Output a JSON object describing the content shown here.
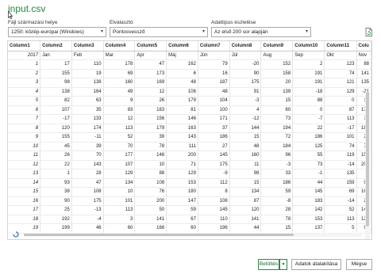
{
  "window": {
    "title": "input.csv"
  },
  "options": {
    "origin": {
      "label": "Fájl származási helye",
      "value": "1250: közép-európai (Windows)"
    },
    "delimiter": {
      "label": "Elválasztó",
      "value": "Pontosvessző"
    },
    "detection": {
      "label": "Adattípus észlelése",
      "value": "Az első 200 sor alapján"
    }
  },
  "table": {
    "headers": [
      "Column1",
      "Column2",
      "Column3",
      "Column4",
      "Column5",
      "Column6",
      "Column7",
      "Column8",
      "Column9",
      "Column10",
      "Column11",
      "Colu"
    ],
    "rows": [
      [
        "2017",
        "Jan",
        "Feb",
        "Mar",
        "Apr",
        "Máj",
        "Jún",
        "Júl",
        "Aug",
        "Sep",
        "Okt",
        "Nov"
      ],
      [
        "1",
        "17",
        "110",
        "178",
        "47",
        "162",
        "79",
        "-20",
        "152",
        "2",
        "123",
        "88"
      ],
      [
        "2",
        "155",
        "19",
        "69",
        "173",
        "6",
        "16",
        "90",
        "158",
        "191",
        "74",
        "141"
      ],
      [
        "3",
        "98",
        "138",
        "160",
        "169",
        "48",
        "187",
        "175",
        "20",
        "191",
        "121",
        "135"
      ],
      [
        "4",
        "138",
        "164",
        "49",
        "12",
        "106",
        "48",
        "91",
        "139",
        "-18",
        "129",
        "-21"
      ],
      [
        "5",
        "82",
        "63",
        "9",
        "26",
        "179",
        "104",
        "-3",
        "15",
        "88",
        "0",
        "16"
      ],
      [
        "6",
        "107",
        "35",
        "83",
        "183",
        "81",
        "100",
        "4",
        "60",
        "0",
        "87",
        "172"
      ],
      [
        "7",
        "-17",
        "133",
        "12",
        "156",
        "146",
        "171",
        "-12",
        "73",
        "-7",
        "113",
        "10"
      ],
      [
        "8",
        "120",
        "174",
        "113",
        "179",
        "163",
        "37",
        "144",
        "194",
        "22",
        "-17",
        "185"
      ],
      [
        "9",
        "155",
        "-11",
        "52",
        "39",
        "143",
        "186",
        "15",
        "72",
        "186",
        "101",
        "26"
      ],
      [
        "10",
        "45",
        "39",
        "70",
        "78",
        "111",
        "27",
        "48",
        "184",
        "125",
        "74",
        "74"
      ],
      [
        "11",
        "26",
        "70",
        "177",
        "146",
        "200",
        "145",
        "160",
        "96",
        "55",
        "119",
        "154"
      ],
      [
        "12",
        "22",
        "143",
        "107",
        "10",
        "71",
        "175",
        "11",
        "-3",
        "73",
        "-14",
        "200"
      ],
      [
        "13",
        "1",
        "28",
        "129",
        "88",
        "129",
        "-9",
        "98",
        "33",
        "-1",
        "135",
        "6"
      ],
      [
        "14",
        "93",
        "47",
        "134",
        "108",
        "153",
        "112",
        "15",
        "186",
        "44",
        "159",
        "91"
      ],
      [
        "15",
        "38",
        "108",
        "10",
        "76",
        "180",
        "8",
        "134",
        "59",
        "145",
        "69",
        "161"
      ],
      [
        "16",
        "90",
        "175",
        "101",
        "200",
        "147",
        "108",
        "87",
        "-8",
        "183",
        "-14",
        "24"
      ],
      [
        "17",
        "25",
        "-13",
        "113",
        "50",
        "59",
        "145",
        "120",
        "28",
        "142",
        "52",
        "148"
      ],
      [
        "18",
        "192",
        "-4",
        "3",
        "141",
        "67",
        "110",
        "141",
        "78",
        "153",
        "113",
        "121"
      ],
      [
        "19",
        "199",
        "46",
        "60",
        "166",
        "60",
        "196",
        "44",
        "15",
        "137",
        "5",
        "99"
      ]
    ]
  },
  "buttons": {
    "load": "Betöltés",
    "transform": "Adatok átalakítása",
    "cancel": "Mégse"
  },
  "colors": {
    "accent": "#1e8a3c"
  }
}
